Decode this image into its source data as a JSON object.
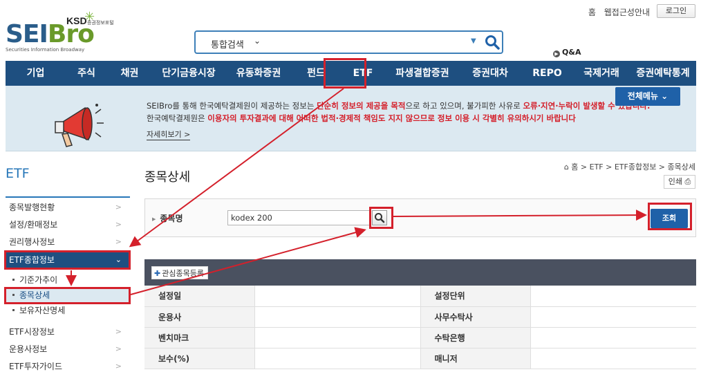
{
  "header": {
    "logo_main_a": "SEI",
    "logo_main_b": "Bro",
    "logo_ksd": "KSD",
    "logo_subtitle": "증권정보포털",
    "logo_tagline": "Securities Information Broadway",
    "top_links": [
      "홈",
      "웹접근성안내"
    ],
    "login_label": "로그인",
    "search_scope": "통합검색",
    "qa_label": "Q&A"
  },
  "nav": {
    "items": [
      "기업",
      "주식",
      "채권",
      "단기금융시장",
      "유동화증권",
      "펀드",
      "ETF",
      "파생결합증권",
      "증권대차",
      "REPO",
      "국제거래",
      "증권예탁통계"
    ],
    "active_index": 6
  },
  "banner": {
    "line1_a": "SEIBro를 통해 한국예탁결제원이 제공하는 정보는 ",
    "line1_b": "단순히 정보의 제공을 목적",
    "line1_c": "으로 하고 있으며, 불가피한 사유로 ",
    "line1_d": "오류·지연·누락이 발생할 수 있습니다.",
    "line2_a": "한국예탁결제원은 ",
    "line2_b": "이용자의 투자결과에 대해 어떠한 법적·경제적 책임도 지지 않으므로 정보 이용 시 각별히 유의하시기 바랍니다",
    "more": "자세히보기 >",
    "allmenu": "전체메뉴"
  },
  "sidebar": {
    "title": "ETF",
    "items": [
      {
        "label": "종목발행현황"
      },
      {
        "label": "설정/환매정보"
      },
      {
        "label": "권리행사정보"
      },
      {
        "label": "ETF종합정보"
      }
    ],
    "sub_items": [
      {
        "label": "기준가추이"
      },
      {
        "label": "종목상세"
      },
      {
        "label": "보유자산명세"
      }
    ],
    "items_after": [
      {
        "label": "ETF시장정보"
      },
      {
        "label": "운용사정보"
      },
      {
        "label": "ETF투자가이드"
      }
    ]
  },
  "main": {
    "title": "종목상세",
    "breadcrumb": "홈 > ETF > ETF종합정보 > 종목상세",
    "print_label": "인쇄",
    "search_label": "종목명",
    "search_value": "kodex 200",
    "query_button": "조회",
    "fav_button": "관심종목등록",
    "table": [
      [
        "설정일",
        "",
        "설정단위",
        ""
      ],
      [
        "운용사",
        "",
        "사무수탁사",
        ""
      ],
      [
        "벤치마크",
        "",
        "수탁은행",
        ""
      ],
      [
        "보수(%)",
        "",
        "매니저",
        ""
      ]
    ]
  },
  "colors": {
    "nav_bg": "#1e4f80",
    "accent_blue": "#1f61a8",
    "annotation_red": "#d4202b"
  }
}
